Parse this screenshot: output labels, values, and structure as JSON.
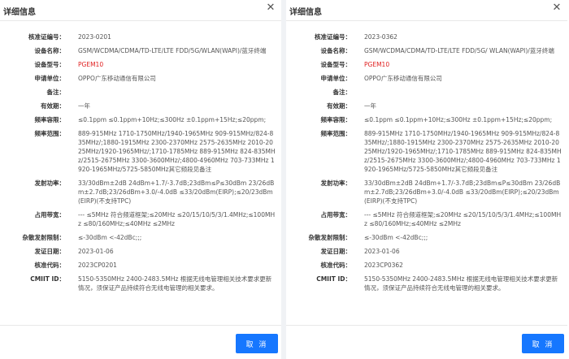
{
  "panels": [
    {
      "title": "详细信息",
      "cancel_label": "取 消",
      "fields": [
        {
          "label": "核准证编号：",
          "value": "2023-0201"
        },
        {
          "label": "设备名称：",
          "value": "GSM/WCDMA/CDMA/TD-LTE/LTE FDD/5G/WLAN(WAPI)/蓝牙终端"
        },
        {
          "label": "设备型号：",
          "value": "PGEM10",
          "highlight": true
        },
        {
          "label": "申请单位：",
          "value": "OPPO广东移动通信有限公司"
        },
        {
          "label": "备注：",
          "value": ""
        },
        {
          "label": "有效期：",
          "value": "一年"
        },
        {
          "label": "频率容限：",
          "value": "≤0.1ppm ≤0.1ppm+10Hz;≤300Hz ±0.1ppm+15Hz;≤20ppm;"
        },
        {
          "label": "频率范围：",
          "value": "889-915MHz 1710-1750MHz/1940-1965MHz 909-915MHz/824-835MHz/;1880-1915MHz 2300-2370MHz 2575-2635MHz 2010-2025MHz/1920-1965MHz/;1710-1785MHz 889-915MHz 824-835MHz/2515-2675MHz 3300-3600MHz/;4800-4960MHz 703-733MHz 1920-1965MHz/5725-5850MHz其它频段见备注"
        },
        {
          "label": "发射功率：",
          "value": "33/30dBm±2dB 24dBm+1.7/-3.7dB;23dBm≤P≤30dBm 23/26dBm±2.7dB;23/26dBm+3.0/-4.0dB ≤33/20dBm(EIRP);≤20/23dBm(EIRP)(不支持TPC)"
        },
        {
          "label": "占用带宽：",
          "value": "--- ≤5MHz 符合频道框架;≤20MHz ≤20/15/10/5/3/1.4MHz;≤100MHz ≤80/160MHz;≤40MHz ≤2MHz"
        },
        {
          "label": "杂散发射限制：",
          "value": "≤-30dBm <-42dBc;;;"
        },
        {
          "label": "发证日期：",
          "value": "2023-01-06"
        },
        {
          "label": "核准代码：",
          "value": "2023CP0201"
        },
        {
          "label": "CMIIT ID：",
          "value": "5150-5350MHz 2400-2483.5MHz 根据无线电管理相关技术要求更新情况，须保证产品持续符合无线电管理的相关要求。"
        }
      ]
    },
    {
      "title": "详细信息",
      "cancel_label": "取 消",
      "fields": [
        {
          "label": "核准证编号：",
          "value": "2023-0362"
        },
        {
          "label": "设备名称：",
          "value": "GSM/WCDMA/CDMA/TD-LTE/LTE FDD/5G/ WLAN(WAPI)/蓝牙终端"
        },
        {
          "label": "设备型号：",
          "value": "PGEM10",
          "highlight": true
        },
        {
          "label": "申请单位：",
          "value": "OPPO广东移动通信有限公司"
        },
        {
          "label": "备注：",
          "value": ""
        },
        {
          "label": "有效期：",
          "value": "一年"
        },
        {
          "label": "频率容限：",
          "value": "≤0.1ppm ≤0.1ppm+10Hz;≤300Hz ±0.1ppm+15Hz;≤20ppm;"
        },
        {
          "label": "频率范围：",
          "value": "889-915MHz 1710-1750MHz/1940-1965MHz 909-915MHz/824-835MHz/;1880-1915MHz 2300-2370MHz 2575-2635MHz 2010-2025MHz/1920-1965MHz/;1710-1785MHz 889-915MHz 824-835MHz/2515-2675MHz 3300-3600MHz/;4800-4960MHz 703-733MHz 1920-1965MHz/5725-5850MHz其它频段见备注"
        },
        {
          "label": "发射功率：",
          "value": "33/30dBm±2dB 24dBm+1.7/-3.7dB;23dBm≤P≤30dBm 23/26dBm±2.7dB;23/26dBm+3.0/-4.0dB ≤33/20dBm(EIRP);≤20/23dBm(EIRP)(不支持TPC)"
        },
        {
          "label": "占用带宽：",
          "value": "--- ≤5MHz 符合频道框架;≤20MHz ≤20/15/10/5/3/1.4MHz;≤100MHz ≤80/160MHz;≤40MHz ≤2MHz"
        },
        {
          "label": "杂散发射限制：",
          "value": "≤-30dBm <-42dBc;;;"
        },
        {
          "label": "发证日期：",
          "value": "2023-01-06"
        },
        {
          "label": "核准代码：",
          "value": "2023CP0362"
        },
        {
          "label": "CMIIT ID：",
          "value": "5150-5350MHz 2400-2483.5MHz 根据无线电管理相关技术要求更新情况，须保证产品持续符合无线电管理的相关要求。"
        }
      ]
    }
  ],
  "colors": {
    "accent": "#1677ff",
    "highlight": "#e02020"
  }
}
